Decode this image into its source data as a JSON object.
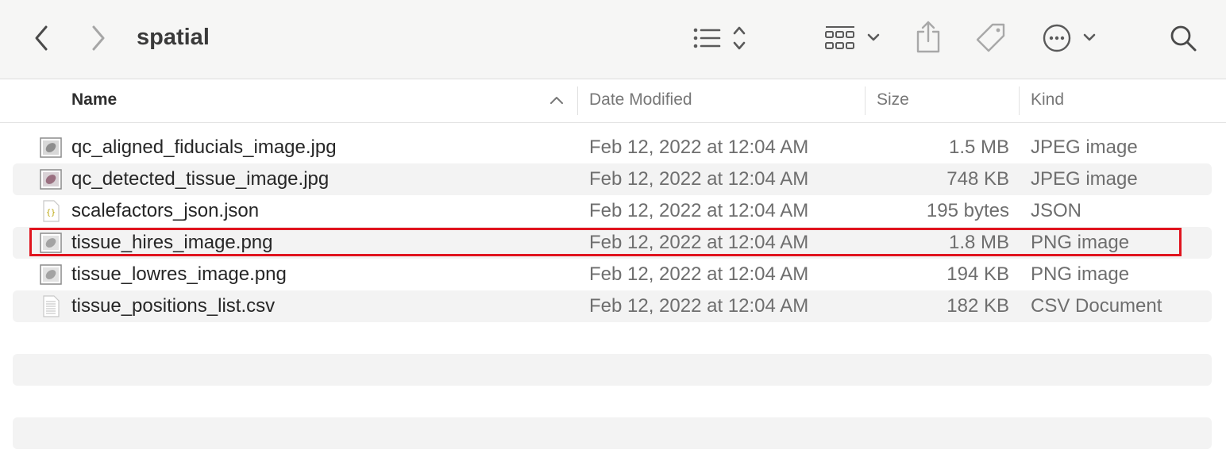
{
  "window": {
    "title": "spatial"
  },
  "toolbar": {
    "back": "back-icon",
    "forward": "forward-icon",
    "view": "list-view-icon",
    "group": "grid-group-icon",
    "share": "share-icon",
    "tags": "tag-icon",
    "more": "more-icon",
    "search": "search-icon"
  },
  "columns": {
    "name": "Name",
    "date": "Date Modified",
    "size": "Size",
    "kind": "Kind"
  },
  "files": [
    {
      "name": "qc_aligned_fiducials_image.jpg",
      "date": "Feb 12, 2022 at 12:04 AM",
      "size": "1.5 MB",
      "kind": "JPEG image",
      "icon": "image-file-icon"
    },
    {
      "name": "qc_detected_tissue_image.jpg",
      "date": "Feb 12, 2022 at 12:04 AM",
      "size": "748 KB",
      "kind": "JPEG image",
      "icon": "image-file-icon"
    },
    {
      "name": "scalefactors_json.json",
      "date": "Feb 12, 2022 at 12:04 AM",
      "size": "195 bytes",
      "kind": "JSON",
      "icon": "json-file-icon"
    },
    {
      "name": "tissue_hires_image.png",
      "date": "Feb 12, 2022 at 12:04 AM",
      "size": "1.8 MB",
      "kind": "PNG image",
      "icon": "image-file-icon"
    },
    {
      "name": "tissue_lowres_image.png",
      "date": "Feb 12, 2022 at 12:04 AM",
      "size": "194 KB",
      "kind": "PNG image",
      "icon": "image-file-icon"
    },
    {
      "name": "tissue_positions_list.csv",
      "date": "Feb 12, 2022 at 12:04 AM",
      "size": "182 KB",
      "kind": "CSV Document",
      "icon": "csv-file-icon"
    }
  ],
  "highlighted_file": "tissue_hires_image.png",
  "colors": {
    "highlight": "#e0141e",
    "stripe": "#f3f3f3",
    "toolbar": "#f6f6f5"
  }
}
